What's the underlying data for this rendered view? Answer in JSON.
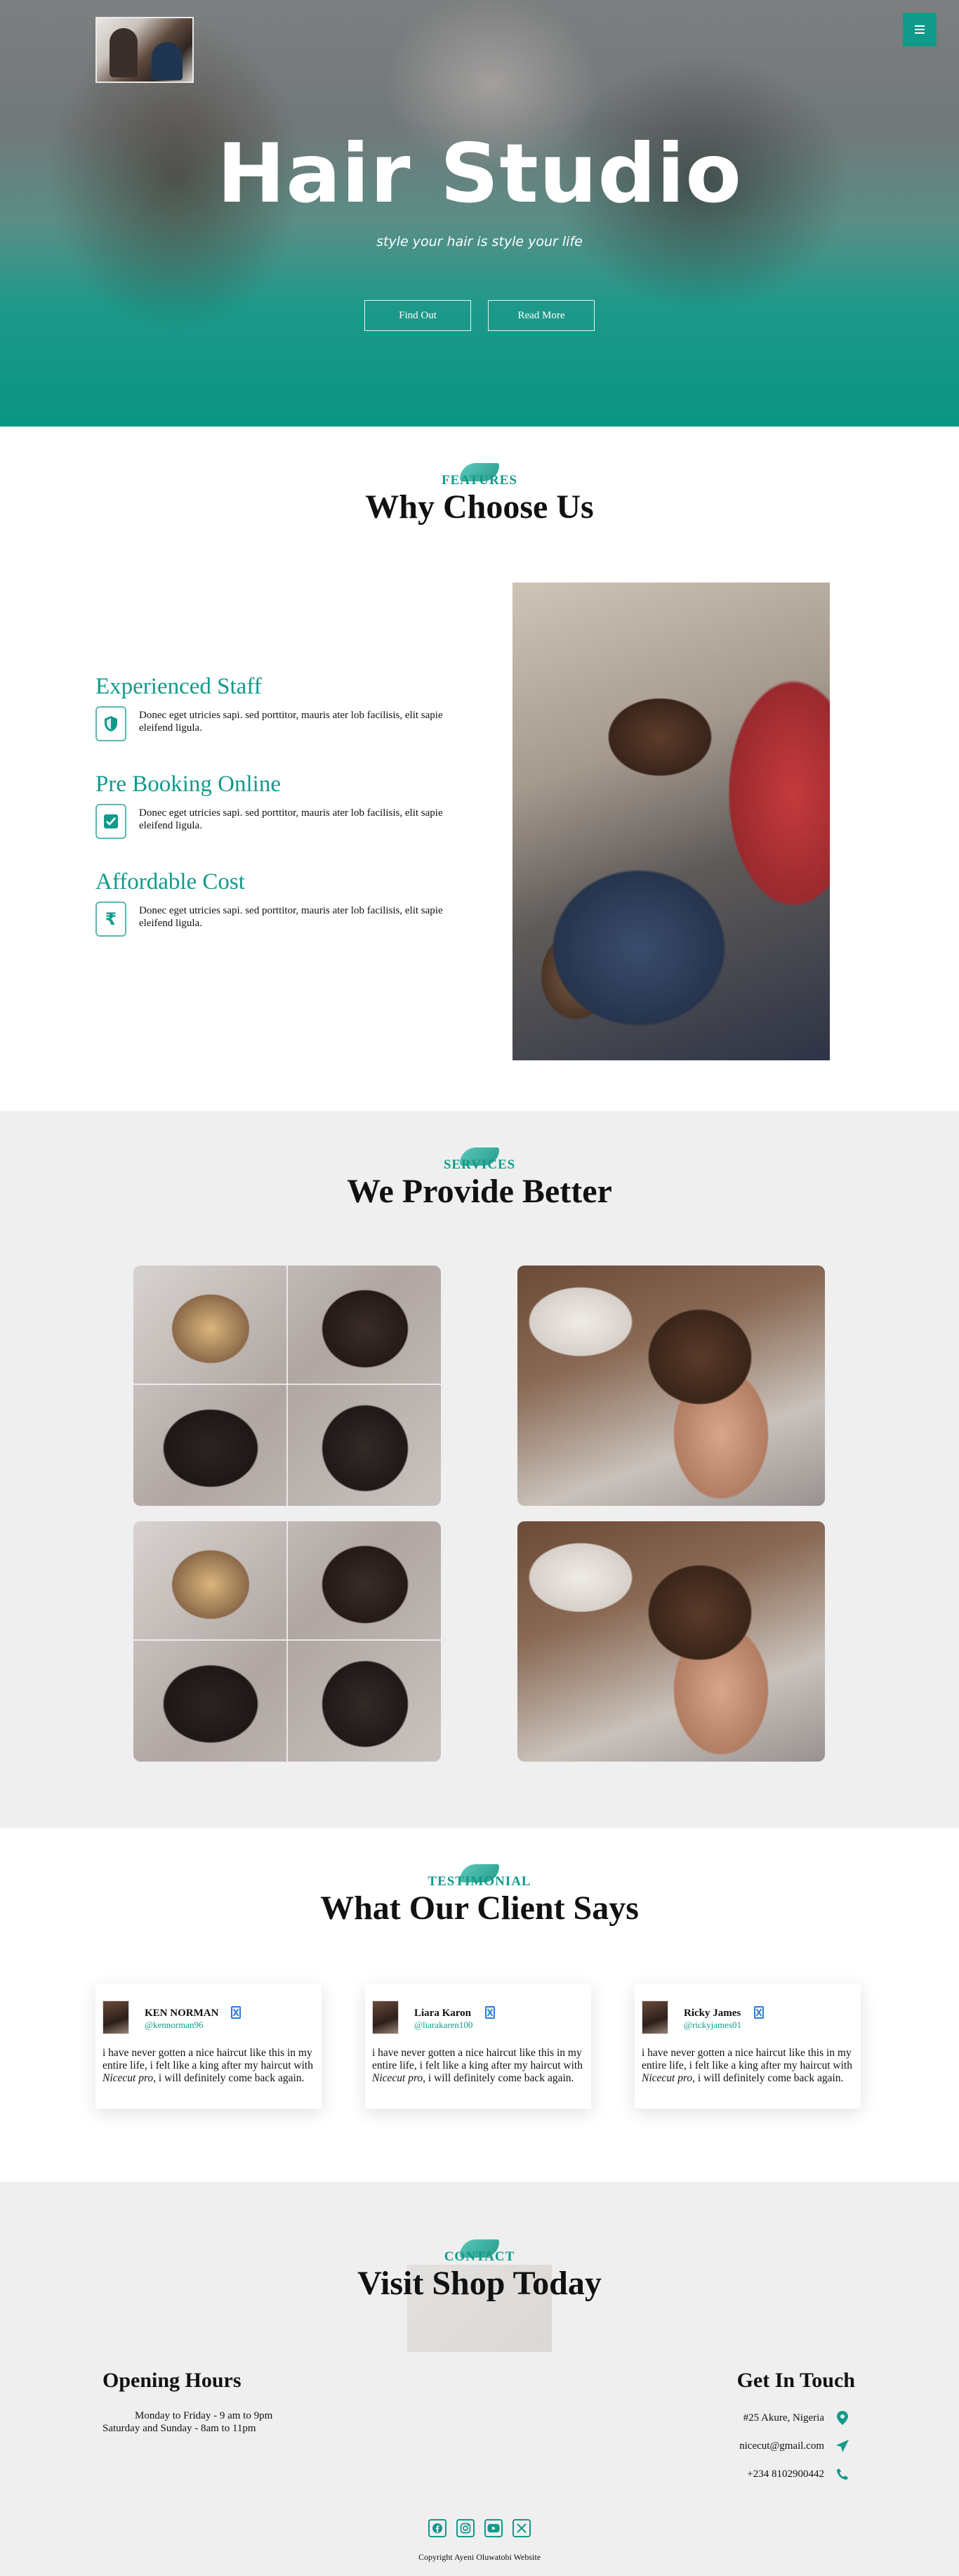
{
  "hero": {
    "title": "Hair Studio",
    "subtitle": "style your hair is style your life",
    "btn_find": "Find Out",
    "btn_read": "Read More"
  },
  "features": {
    "tag": "FEATURES",
    "title": "Why Choose Us",
    "items": [
      {
        "title": "Experienced Staff",
        "text": "Donec eget utricies sapi. sed porttitor, mauris ater lob facilisis, elit sapie eleifend ligula.",
        "icon": "shield-icon"
      },
      {
        "title": "Pre Booking Online",
        "text": "Donec eget utricies sapi. sed porttitor, mauris ater lob facilisis, elit sapie eleifend ligula.",
        "icon": "check-square-icon"
      },
      {
        "title": "Affordable Cost",
        "text": "Donec eget utricies sapi. sed porttitor, mauris ater lob facilisis, elit sapie eleifend ligula.",
        "icon": "rupee-icon"
      }
    ]
  },
  "services": {
    "tag": "SERVICES",
    "title": "We Provide Better"
  },
  "testimonial": {
    "tag": "TESTIMONIAL",
    "title": "What Our Client Says",
    "cards": [
      {
        "name": "KEN NORMAN",
        "handle": "@kennorman96",
        "body_pre": "i have never gotten a nice haircut like this in my entire life, i felt like a king after my haircut with ",
        "brand": "Nicecut pro",
        "body_post": ", i will definitely come back again."
      },
      {
        "name": "Liara Karon",
        "handle": "@liarakaren100",
        "body_pre": "i have never gotten a nice haircut like this in my entire life, i felt like a king after my haircut with ",
        "brand": "Nicecut pro",
        "body_post": ", i will definitely come back again."
      },
      {
        "name": "Ricky James",
        "handle": "@rickyjames01",
        "body_pre": "i have never gotten a nice haircut like this in my entire life, i felt like a king after my haircut with ",
        "brand": "Nicecut pro",
        "body_post": ", i will definitely come back again."
      }
    ]
  },
  "contact": {
    "tag": "CONTACT",
    "title": "Visit Shop Today",
    "hours_title": "Opening Hours",
    "hours_weekday": "Monday to Friday - 9 am to 9pm",
    "hours_weekend": "Saturday and Sunday - 8am to 11pm",
    "touch_title": "Get In Touch",
    "address": "#25 Akure, Nigeria",
    "email": "nicecut@gmail.com",
    "phone": "+234 8102900442",
    "copyright": "Copyright Ayeni Oluwatobi Website"
  },
  "colors": {
    "accent": "#119a8a",
    "section_gray": "#efefef"
  }
}
